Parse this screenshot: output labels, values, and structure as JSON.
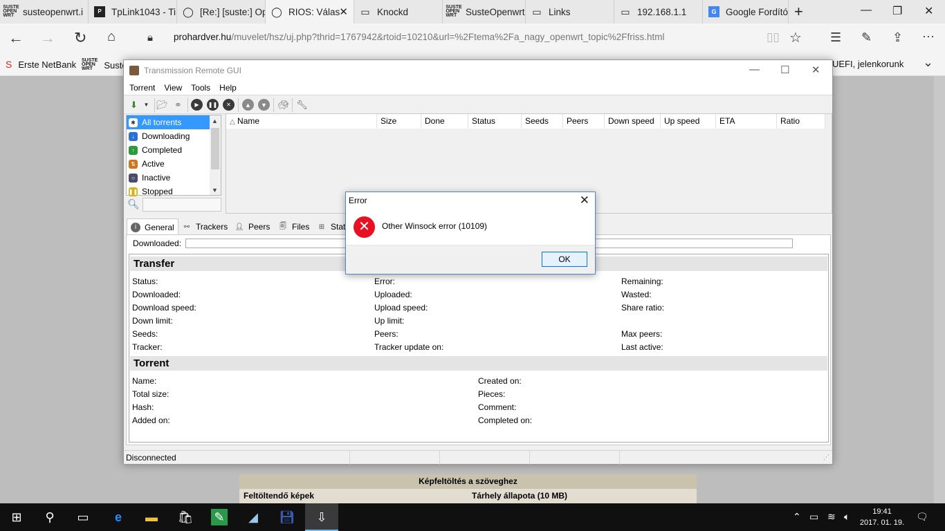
{
  "browser": {
    "tabs": [
      {
        "label": "susteopenwrt.i",
        "icon": "suse-logo"
      },
      {
        "label": "TpLink1043 - Ti",
        "icon": "tplink-logo"
      },
      {
        "label": "[Re:] [suste:] Op",
        "icon": "chat-icon"
      },
      {
        "label": "RIOS: Válas",
        "icon": "chat-icon",
        "active": true
      },
      {
        "label": "Knockd",
        "icon": "page-icon"
      },
      {
        "label": "SusteOpenwrt",
        "icon": "suse-logo"
      },
      {
        "label": "Links",
        "icon": "page-icon"
      },
      {
        "label": "192.168.1.1",
        "icon": "page-icon"
      },
      {
        "label": "Google Fordító",
        "icon": "google-translate-icon"
      }
    ],
    "address_domain": "prohardver.hu",
    "address_path": "/muvelet/hsz/uj.php?thrid=1767942&rtoid=10210&url=%2Ftema%2Fa_nagy_openwrt_topic%2Ffriss.html",
    "favorites": [
      {
        "label": "Erste NetBank"
      },
      {
        "label": "SusteO"
      },
      {
        "label": "UEFI, jelenkorunk"
      }
    ]
  },
  "background_page": {
    "header": "Képfeltöltés a szöveghez",
    "left_label": "Feltöltendő képek",
    "right_label": "Tárhely állapota (10 MB)"
  },
  "app": {
    "title": "Transmission Remote GUI",
    "menu": [
      "Torrent",
      "View",
      "Tools",
      "Help"
    ],
    "filters": [
      {
        "label": "All torrents",
        "color": "#333333"
      },
      {
        "label": "Downloading",
        "color": "#2a6fd6"
      },
      {
        "label": "Completed",
        "color": "#2a9a3a"
      },
      {
        "label": "Active",
        "color": "#d0751e"
      },
      {
        "label": "Inactive",
        "color": "#4a4a6a"
      },
      {
        "label": "Stopped",
        "color": "#d6b21e"
      }
    ],
    "columns": [
      "Name",
      "Size",
      "Done",
      "Status",
      "Seeds",
      "Peers",
      "Down speed",
      "Up speed",
      "ETA",
      "Ratio"
    ],
    "detail_tabs": [
      "General",
      "Trackers",
      "Peers",
      "Files",
      "Stat"
    ],
    "downloaded_label": "Downloaded:",
    "transfer": {
      "title": "Transfer",
      "col1": [
        "Status:",
        "Downloaded:",
        "Download speed:",
        "Down limit:",
        "Seeds:",
        "Tracker:"
      ],
      "col2": [
        "Error:",
        "Uploaded:",
        "Upload speed:",
        "Up limit:",
        "Peers:",
        "Tracker update on:"
      ],
      "col3": [
        "Remaining:",
        "Wasted:",
        "Share ratio:",
        "",
        "Max peers:",
        "Last active:"
      ]
    },
    "torrent": {
      "title": "Torrent",
      "col1": [
        "Name:",
        "Total size:",
        "Hash:",
        "Added on:"
      ],
      "col2": [
        "Created on:",
        "Pieces:",
        "Comment:",
        "Completed on:"
      ]
    },
    "status": "Disconnected"
  },
  "dialog": {
    "title": "Error",
    "message": "Other Winsock error (10109)",
    "ok": "OK"
  },
  "taskbar": {
    "time": "19:41",
    "date": "2017. 01. 19."
  }
}
